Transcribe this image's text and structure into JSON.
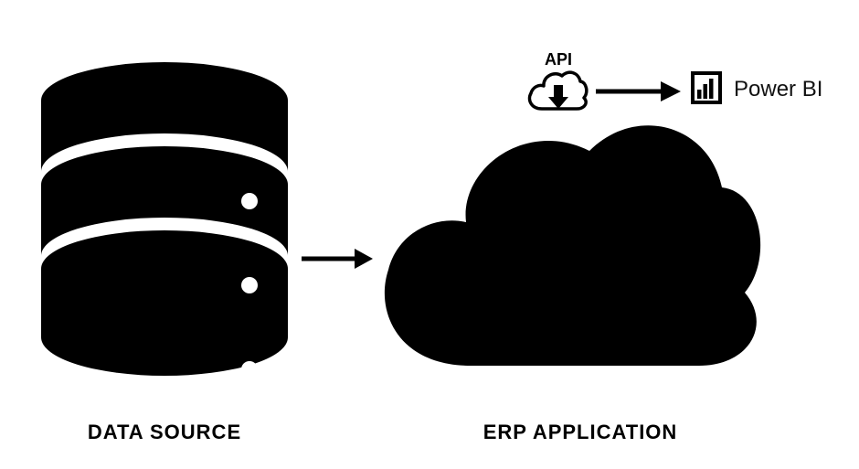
{
  "labels": {
    "data_source": "DATA SOURCE",
    "erp_application": "ERP APPLICATION",
    "api": "API",
    "power_bi": "Power BI"
  },
  "icons": {
    "database": "database-icon",
    "cloud": "cloud-icon",
    "api_cloud": "api-cloud-icon",
    "power_bi": "power-bi-icon",
    "arrow1": "arrow-icon",
    "arrow2": "arrow-icon"
  },
  "flow": [
    {
      "from": "data_source",
      "to": "erp_application"
    },
    {
      "from": "erp_application_api",
      "to": "power_bi"
    }
  ]
}
